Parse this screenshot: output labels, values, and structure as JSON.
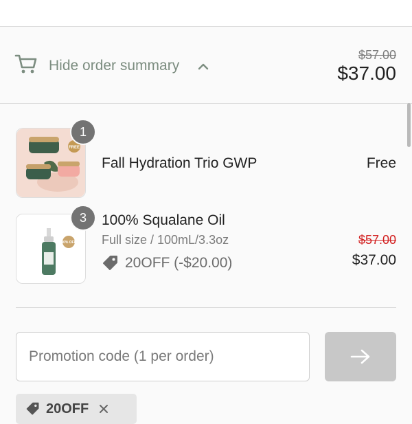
{
  "summary": {
    "toggle_label": "Hide order summary",
    "original_total": "$57.00",
    "total": "$37.00"
  },
  "items": [
    {
      "quantity": "1",
      "title": "Fall Hydration Trio GWP",
      "price": "Free",
      "thumb_badge": "FREE"
    },
    {
      "quantity": "3",
      "title": "100% Squalane Oil",
      "variant": "Full size / 100mL/3.3oz",
      "discount": "20OFF (-$20.00)",
      "original_price": "$57.00",
      "price": "$37.00",
      "thumb_badge": "40% OFF"
    }
  ],
  "promo": {
    "placeholder": "Promotion code (1 per order)",
    "applied_code": "20OFF"
  },
  "colors": {
    "accent_green": "#7c8d80",
    "strike_red": "#d21f1f",
    "badge_gray": "#737373"
  }
}
